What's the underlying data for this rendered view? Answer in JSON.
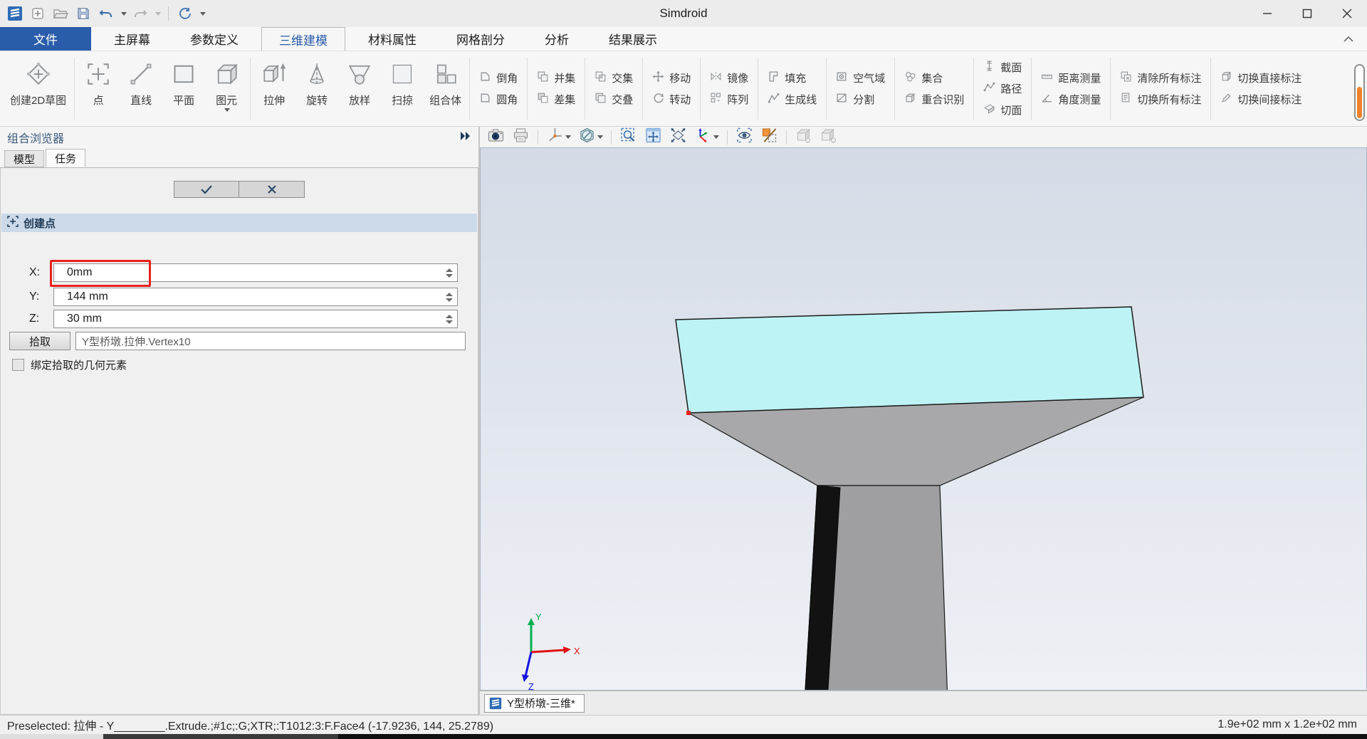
{
  "window": {
    "title": "Simdroid"
  },
  "quick_access": {
    "icons": [
      "app-logo",
      "new-file-icon",
      "open-file-icon",
      "save-icon",
      "undo-icon",
      "redo-icon",
      "refresh-icon"
    ]
  },
  "menu": {
    "file_button": "文件",
    "tabs": [
      "主屏幕",
      "参数定义",
      "三维建模",
      "材料属性",
      "网格剖分",
      "分析",
      "结果展示"
    ],
    "active_tab": "三维建模"
  },
  "ribbon": {
    "big_groups": [
      {
        "items": [
          {
            "label": "创建2D草图",
            "icon": "sketch2d-icon"
          }
        ]
      },
      {
        "items": [
          {
            "label": "点",
            "icon": "point-icon"
          },
          {
            "label": "直线",
            "icon": "line-icon"
          },
          {
            "label": "平面",
            "icon": "plane-icon"
          },
          {
            "label": "图元",
            "icon": "primitive-icon",
            "dropdown": true
          }
        ]
      },
      {
        "items": [
          {
            "label": "拉伸",
            "icon": "extrude-icon"
          },
          {
            "label": "旋转",
            "icon": "revolve-icon"
          },
          {
            "label": "放样",
            "icon": "loft-icon"
          },
          {
            "label": "扫掠",
            "icon": "sweep-icon"
          },
          {
            "label": "组合体",
            "icon": "composite-icon"
          }
        ]
      }
    ],
    "small_columns": [
      {
        "items": [
          {
            "label": "倒角",
            "icon": "chamfer-icon"
          },
          {
            "label": "圆角",
            "icon": "fillet-icon"
          }
        ]
      },
      {
        "items": [
          {
            "label": "并集",
            "icon": "union-icon"
          },
          {
            "label": "差集",
            "icon": "subtract-icon"
          }
        ]
      },
      {
        "items": [
          {
            "label": "交集",
            "icon": "intersect-icon"
          },
          {
            "label": "交叠",
            "icon": "overlap-icon"
          }
        ]
      },
      {
        "items": [
          {
            "label": "移动",
            "icon": "move-icon"
          },
          {
            "label": "转动",
            "icon": "rotate-icon"
          }
        ]
      },
      {
        "items": [
          {
            "label": "镜像",
            "icon": "mirror-icon"
          },
          {
            "label": "阵列",
            "icon": "array-icon"
          }
        ]
      },
      {
        "items": [
          {
            "label": "填充",
            "icon": "fill-icon"
          },
          {
            "label": "生成线",
            "icon": "generate-line-icon"
          }
        ]
      },
      {
        "items": [
          {
            "label": "空气域",
            "icon": "air-domain-icon"
          },
          {
            "label": "分割",
            "icon": "split-icon"
          }
        ]
      },
      {
        "items": [
          {
            "label": "集合",
            "icon": "set-icon"
          },
          {
            "label": "重合识别",
            "icon": "coincide-icon"
          }
        ]
      },
      {
        "items": [
          {
            "label": "截面",
            "icon": "section-icon"
          },
          {
            "label": "路径",
            "icon": "path-icon"
          },
          {
            "label": "切面",
            "icon": "cut-plane-icon"
          }
        ]
      },
      {
        "items": [
          {
            "label": "距离测量",
            "icon": "distance-measure-icon"
          },
          {
            "label": "角度测量",
            "icon": "angle-measure-icon"
          }
        ]
      },
      {
        "items": [
          {
            "label": "清除所有标注",
            "icon": "clear-annotations-icon"
          },
          {
            "label": "切换所有标注",
            "icon": "toggle-annotations-icon"
          }
        ]
      },
      {
        "items": [
          {
            "label": "切换直接标注",
            "icon": "toggle-direct-annotation-icon"
          },
          {
            "label": "切换间接标注",
            "icon": "toggle-indirect-annotation-icon"
          }
        ]
      }
    ]
  },
  "panel": {
    "title": "组合浏览器",
    "tabs": [
      {
        "label": "模型"
      },
      {
        "label": "任务"
      }
    ],
    "active_tab": "任务",
    "section_title": "创建点",
    "fields": [
      {
        "label": "X:",
        "value": "0mm",
        "highlighted": true
      },
      {
        "label": "Y:",
        "value": "144 mm",
        "highlighted": false
      },
      {
        "label": "Z:",
        "value": "30 mm",
        "highlighted": false
      }
    ],
    "pick_button": "拾取",
    "pick_value": "Y型桥墩.拉伸.Vertex10",
    "bind_checkbox_label": "绑定拾取的几何元素",
    "checkbox_checked": false
  },
  "viewport": {
    "toolbar_icons": [
      "screenshot-camera-icon",
      "print-icon",
      "triad-display-icon",
      "section-view-off-icon",
      "zoom-window-icon",
      "pan-icon",
      "zoom-fit-icon",
      "view-orientation-icon",
      "visibility-eye-icon",
      "clip-toggle-icon",
      "show-body-icon",
      "show-body-alt-icon"
    ],
    "doc_tab": "Y型桥墩-三维*",
    "triad": {
      "x": "X",
      "y": "Y",
      "z": "Z"
    }
  },
  "statusbar": {
    "left": "Preselected: 拉伸 - Y________.Extrude.;#1c;:G;XTR;:T1012:3:F.Face4 (-17.9236, 144, 25.2789)",
    "right": "1.9e+02 mm x 1.2e+02 mm"
  },
  "colors": {
    "accent_blue": "#2a5caa",
    "highlight_red": "#e8211d",
    "selection_cyan": "#bdf3f5",
    "pier_gray": "#a8a8aa",
    "scroll_orange": "#f0812c"
  }
}
